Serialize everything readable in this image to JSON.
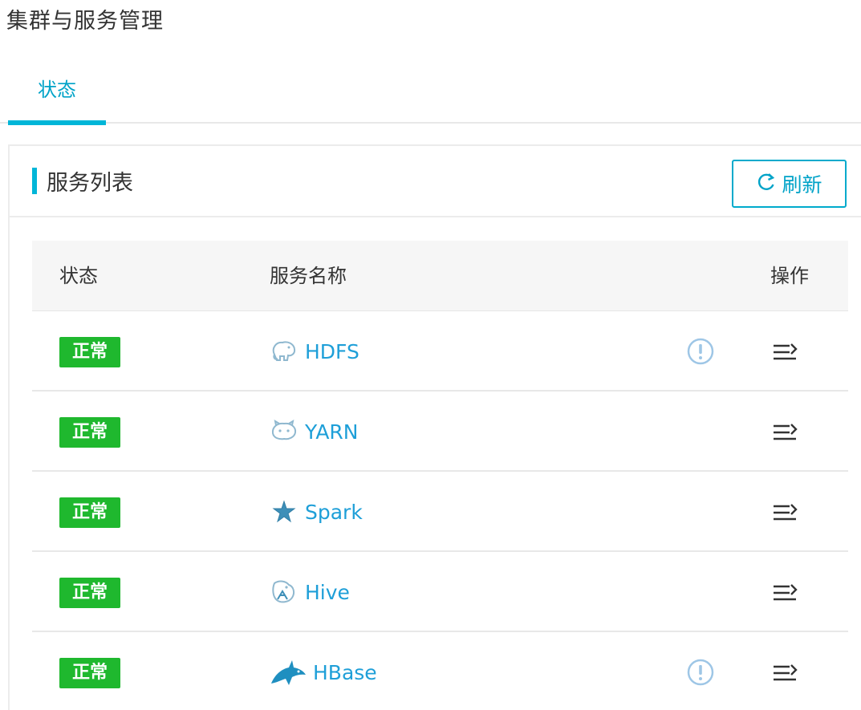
{
  "page": {
    "title": "集群与服务管理"
  },
  "tabs": [
    {
      "label": "状态",
      "active": true
    }
  ],
  "panel": {
    "title": "服务列表",
    "refresh_label": "刷新"
  },
  "table": {
    "columns": {
      "status": "状态",
      "name": "服务名称",
      "ops": "操作"
    },
    "rows": [
      {
        "status": "正常",
        "name": "HDFS",
        "icon": "hdfs-elephant-icon",
        "warning": true
      },
      {
        "status": "正常",
        "name": "YARN",
        "icon": "yarn-cat-icon",
        "warning": false
      },
      {
        "status": "正常",
        "name": "Spark",
        "icon": "spark-star-icon",
        "warning": false
      },
      {
        "status": "正常",
        "name": "Hive",
        "icon": "hive-bee-icon",
        "warning": false
      },
      {
        "status": "正常",
        "name": "HBase",
        "icon": "hbase-orca-icon",
        "warning": true
      }
    ]
  },
  "colors": {
    "accent": "#00b6d8",
    "link": "#1e9fd8",
    "status_ok": "#1fb82e",
    "warning_icon": "#9ec6e6"
  }
}
